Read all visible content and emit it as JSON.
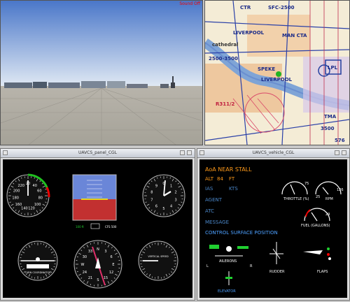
{
  "sim": {
    "status_label": "Sound Off"
  },
  "map": {
    "labels": [
      "CTR",
      "SFC-2500",
      "LIVERPOOL",
      "MAN CTA",
      "2500-3500",
      "LPL",
      "LIVERPOOL",
      "TMA",
      "3500",
      "576",
      "cathedral",
      "SPEKE",
      "R311/2"
    ]
  },
  "panel_window": {
    "title": "UAVCS_panel_CGL"
  },
  "vehicle_window": {
    "title": "UAVCS_vehicle_CGL",
    "warning": "AoA NEAR STALL",
    "alt_label": "ALT",
    "alt_value": "84",
    "alt_unit": "FT",
    "ias_label": "IAS",
    "ias_unit": "KTS",
    "agent_label": "AGENT",
    "atc_label": "ATC",
    "message_label": "MESSAGE",
    "section_title": "CONTROL SURFACE POSITION",
    "throttle_label": "THROTTLE (%)",
    "rpm_label": "RPM",
    "fuel_label": "FUEL (GALLONS)",
    "ailerons_label": "AILERONS",
    "elevator_label": "ELEVATOR",
    "rudder_label": "RUDDER",
    "flaps_label": "FLAPS",
    "gauge_ticks": {
      "throttle_max": "75",
      "rpm_low": "25",
      "rpm_high": "126",
      "fuel_max": "29"
    }
  },
  "instruments": {
    "asi_numbers": [
      "20",
      "40",
      "60",
      "80",
      "100",
      "120",
      "140",
      "160",
      "180",
      "200",
      "220"
    ],
    "heading_numbers": [
      "N",
      "3",
      "6",
      "E",
      "12",
      "15",
      "S",
      "21",
      "24",
      "W",
      "30",
      "33"
    ],
    "altimeter_numbers": [
      "0",
      "1",
      "2",
      "3",
      "4",
      "5",
      "6",
      "7",
      "8",
      "9"
    ],
    "labels": {
      "turn": "TURN COORDINATOR",
      "vsi": "VERTICAL SPEED",
      "ld1": "100 ft",
      "ld2": "CFS 500"
    }
  }
}
